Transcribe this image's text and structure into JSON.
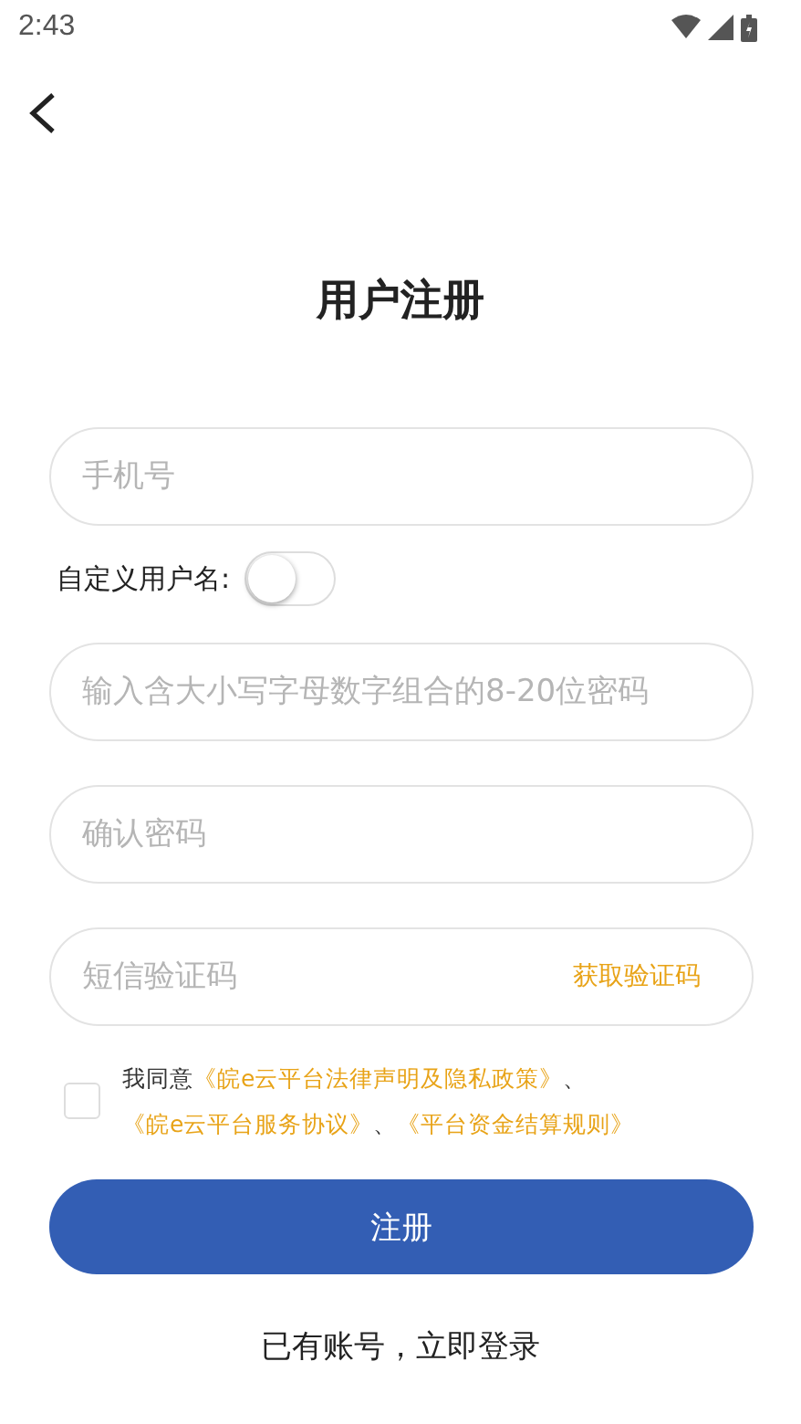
{
  "status_bar": {
    "time": "2:43"
  },
  "title": "用户注册",
  "form": [
    {
      "kind": "input",
      "placeholder": "手机号"
    },
    {
      "kind": "toggle",
      "label": "自定义用户名:",
      "on": false
    },
    {
      "kind": "input",
      "placeholder": "输入含大小写字母数字组合的8-20位密码"
    },
    {
      "kind": "input",
      "placeholder": "确认密码"
    },
    {
      "kind": "code",
      "placeholder": "短信验证码",
      "action": "获取验证码"
    }
  ],
  "agreement": {
    "checked": false,
    "parts": [
      {
        "kind": "plain",
        "text": "我同意"
      },
      {
        "kind": "link",
        "text": "《皖e云平台法律声明及隐私政策》"
      },
      {
        "kind": "plain",
        "text": "、"
      },
      {
        "kind": "link",
        "text": "《皖e云平台服务协议》"
      },
      {
        "kind": "plain",
        "text": "、"
      },
      {
        "kind": "link",
        "text": "《平台资金结算规则》"
      }
    ]
  },
  "submit_button": "注册",
  "login_prompt": "已有账号，立即登录"
}
